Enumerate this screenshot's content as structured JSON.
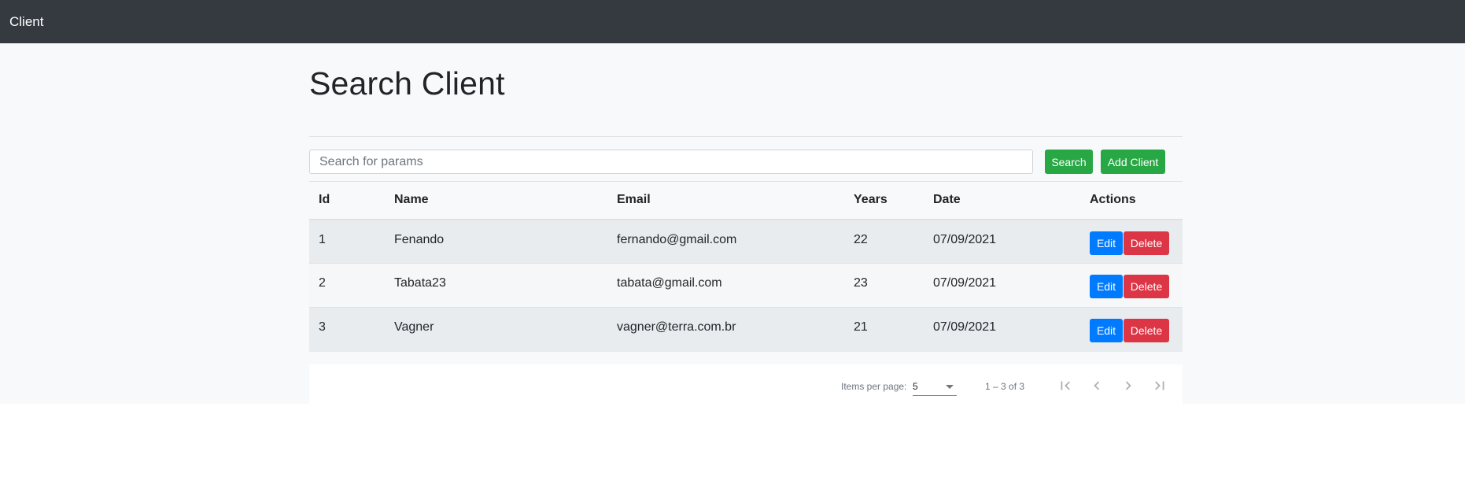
{
  "navbar": {
    "brand": "Client"
  },
  "page": {
    "title": "Search Client"
  },
  "search": {
    "placeholder": "Search for params",
    "value": ""
  },
  "buttons": {
    "search": "Search",
    "add": "Add Client",
    "edit": "Edit",
    "delete": "Delete"
  },
  "table": {
    "headers": [
      "Id",
      "Name",
      "Email",
      "Years",
      "Date",
      "Actions"
    ],
    "rows": [
      {
        "id": "1",
        "name": "Fenando",
        "email": "fernando@gmail.com",
        "years": "22",
        "date": "07/09/2021"
      },
      {
        "id": "2",
        "name": "Tabata23",
        "email": "tabata@gmail.com",
        "years": "23",
        "date": "07/09/2021"
      },
      {
        "id": "3",
        "name": "Vagner",
        "email": "vagner@terra.com.br",
        "years": "21",
        "date": "07/09/2021"
      }
    ]
  },
  "paginator": {
    "items_label": "Items per page:",
    "page_size": "5",
    "range": "1 – 3 of 3",
    "icons": [
      "first-page-icon",
      "prev-page-icon",
      "next-page-icon",
      "last-page-icon"
    ]
  },
  "colors": {
    "navbar": "#343a40",
    "success": "#28a745",
    "primary": "#007bff",
    "danger": "#dc3545"
  }
}
